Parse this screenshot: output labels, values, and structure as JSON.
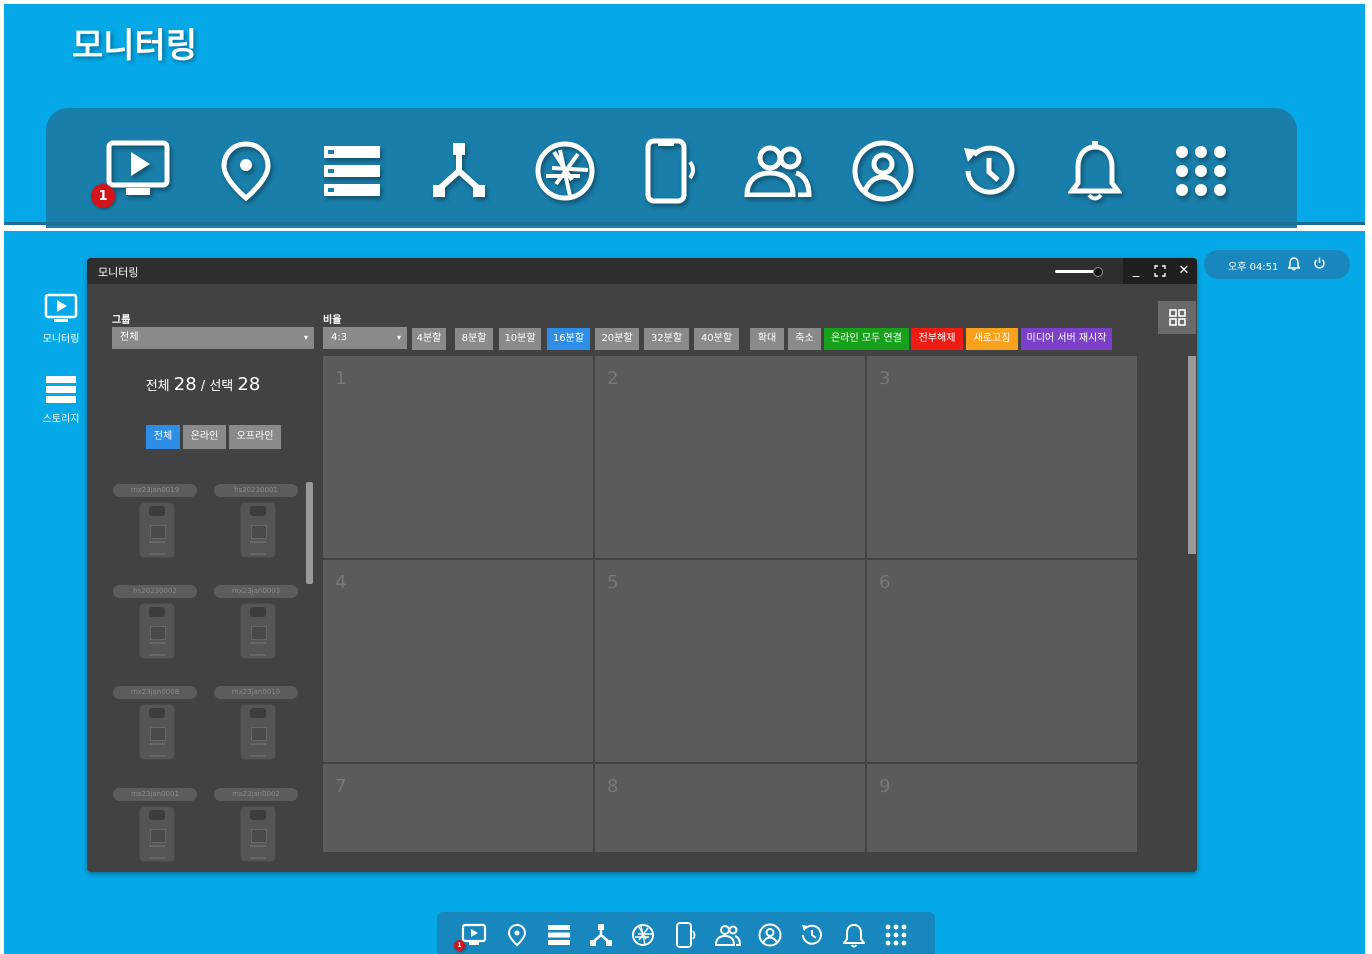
{
  "header": {
    "title": "모니터링",
    "badge_count": "1"
  },
  "dock_items": [
    "monitor-play",
    "location-pin",
    "storage-list",
    "network-tree",
    "camera-aperture",
    "mobile-signal",
    "users",
    "user-circle",
    "history",
    "bell",
    "apps-grid"
  ],
  "desktop": {
    "icons": [
      {
        "label": "모니터링",
        "icon": "monitor-play"
      },
      {
        "label": "스토리지",
        "icon": "storage-list"
      }
    ]
  },
  "window": {
    "title": "모니터링",
    "group": {
      "label": "그룹",
      "value": "전체"
    },
    "ratio": {
      "label": "비율",
      "value": "4:3"
    },
    "split_buttons": [
      "4분할",
      "8분할",
      "10분할",
      "16분할",
      "20분할",
      "32분할",
      "40분할"
    ],
    "active_split": "16분할",
    "zoom_buttons": [
      "확대",
      "축소"
    ],
    "actions": {
      "connect_all": "온라인 모두 연결",
      "release_all": "전부해제",
      "refresh": "새로고침",
      "restart_media": "미디어 서버 재시작"
    },
    "counts": {
      "total_label": "전체",
      "total": "28",
      "sep": "/",
      "selected_label": "선택",
      "selected": "28"
    },
    "filters": [
      "전체",
      "온라인",
      "오프라인"
    ],
    "devices": [
      "mx23jan0019",
      "hs20230001",
      "hs20230002",
      "mx23jan0003",
      "mx23jan0008",
      "mx23jan0010",
      "ms23jan0001",
      "ms23jan0002"
    ],
    "cells": [
      "1",
      "2",
      "3",
      "4",
      "5",
      "6",
      "7",
      "8",
      "9"
    ]
  },
  "tray": {
    "time": "오후 04:51"
  },
  "colors": {
    "background": "#05a9e8",
    "dock": "#197eaa",
    "active": "#2e8ee6",
    "green": "#17a01c",
    "red": "#ee1c14",
    "orange": "#f7a11d",
    "purple": "#7c3fc8"
  }
}
